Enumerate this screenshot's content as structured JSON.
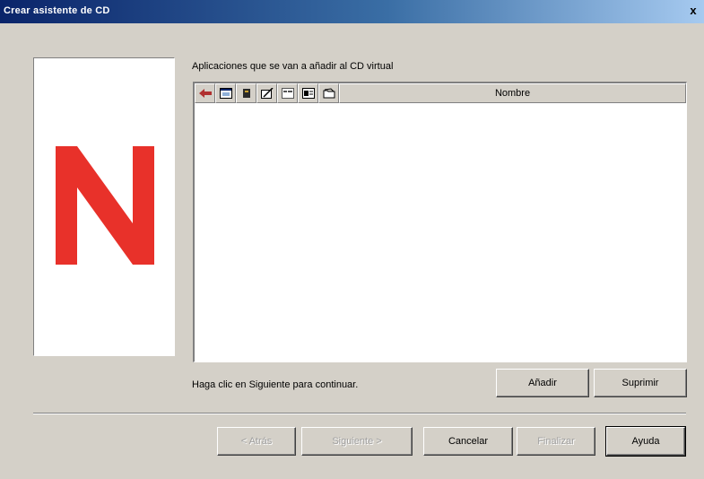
{
  "window": {
    "title": "Crear asistente de CD",
    "close_label": "x"
  },
  "logo": {
    "letter_color": "#e8312a"
  },
  "list": {
    "label": "Aplicaciones que se van a añadir al CD virtual",
    "icon_columns": [
      "app-icon",
      "window-icon",
      "book-icon",
      "edit-icon",
      "properties-icon",
      "display-icon",
      "folder-icon"
    ],
    "name_column": "Nombre",
    "rows": []
  },
  "status": "Haga clic en Siguiente para continuar.",
  "actions": {
    "add": "Añadir",
    "remove": "Suprimir"
  },
  "footer": {
    "back": "< Atrás",
    "next": "Siguiente >",
    "cancel": "Cancelar",
    "finish": "Finalizar",
    "help": "Ayuda"
  }
}
